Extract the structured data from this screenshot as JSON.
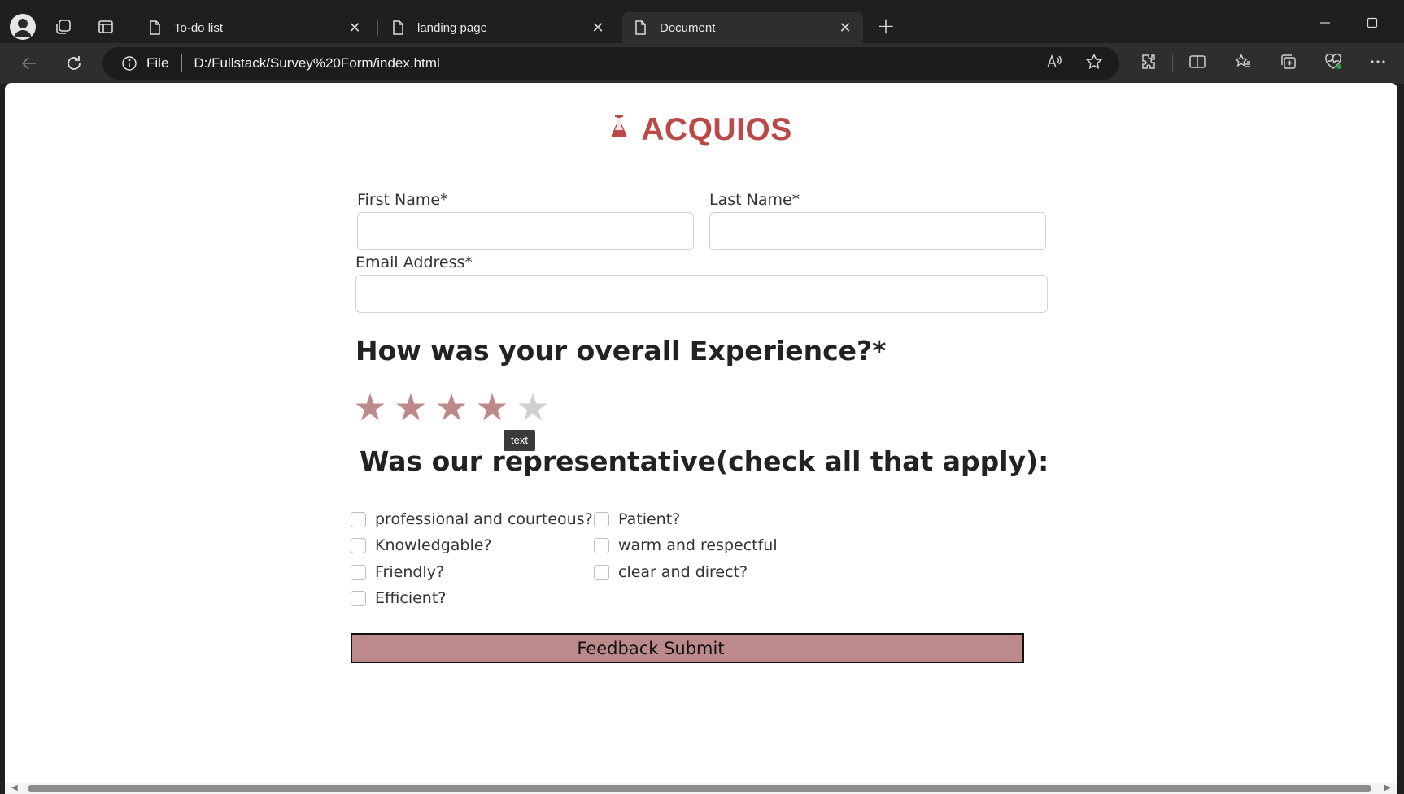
{
  "browser": {
    "tabs": [
      {
        "title": "To-do list",
        "active": false
      },
      {
        "title": "landing page",
        "active": false
      },
      {
        "title": "Document",
        "active": true
      }
    ],
    "address": {
      "scheme": "File",
      "url": "D:/Fullstack/Survey%20Form/index.html"
    }
  },
  "page": {
    "brand": "ACQUIOS",
    "form": {
      "first_name_label": "First Name*",
      "last_name_label": "Last Name*",
      "email_label": "Email Address*",
      "first_name_value": "",
      "last_name_value": "",
      "email_value": ""
    },
    "experience": {
      "question": "How was your overall Experience?*",
      "rating": 4,
      "max": 5,
      "star_char": "★",
      "tooltip": "text"
    },
    "representative": {
      "question": "Was our representative(check all that apply):",
      "options": [
        "professional and courteous?",
        "Knowledgable?",
        "Friendly?",
        "Efficient?",
        "Patient?",
        "warm and respectful",
        "clear and direct?"
      ]
    },
    "submit_label": "Feedback Submit"
  },
  "colors": {
    "brand": "#b94a48",
    "star_on": "#bc8a8a",
    "star_off": "#d0d0d0",
    "submit_bg": "#bc8a8a"
  }
}
